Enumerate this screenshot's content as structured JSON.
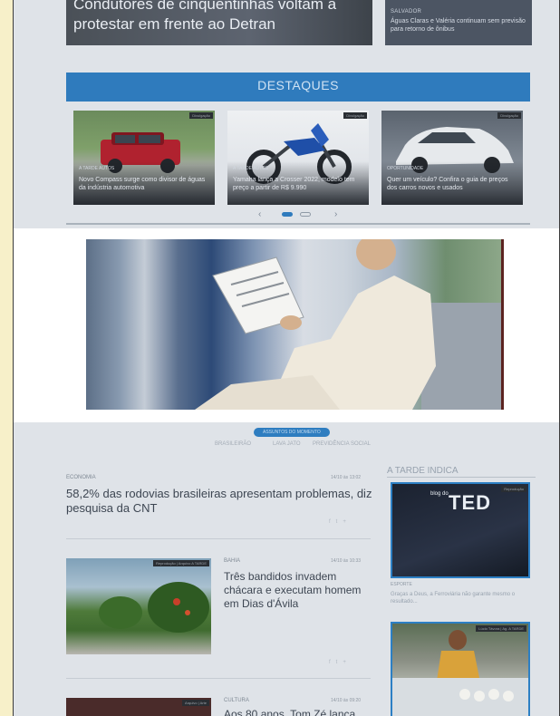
{
  "top": {
    "hero_headline": "Condutores de cinquentinhas voltam a protestar em frente ao Detran",
    "side_kicker": "SALVADOR",
    "side_headline": "Águas Claras e Valéria continuam sem previsão para retorno de ônibus"
  },
  "destaques": {
    "title": "DESTAQUES",
    "cards": [
      {
        "tag": "Divulgação",
        "kicker": "A TARDE AUTOS",
        "caption": "Novo Compass surge como divisor de águas da indústria automotiva"
      },
      {
        "tag": "Divulgação",
        "kicker": "A TARDE AUTOS",
        "caption": "Yamaha lança a Crosser 2022, modelo tem preço a partir de R$ 9.990"
      },
      {
        "tag": "Divulgação",
        "kicker": "OPORTUNIDADE",
        "caption": "Quer um veículo? Confira o guia de preços dos carros novos e usados"
      }
    ],
    "prev": "‹",
    "next": "›"
  },
  "trending": {
    "pill": "ASSUNTOS DO MOMENTO",
    "links": [
      "BRASILEIRÃO",
      "LAVA JATO",
      "PREVIDÊNCIA SOCIAL"
    ]
  },
  "articles": [
    {
      "kicker": "ECONOMIA",
      "time": "14/10 às 13:02",
      "headline": "58,2% das rodovias brasileiras apresentam problemas, diz pesquisa da CNT"
    },
    {
      "kicker": "BAHIA",
      "time": "14/10 às 10:33",
      "headline": "Três bandidos invadem chácara e executam homem em Dias d'Ávila",
      "photo_tag": "Reprodução | Arquivo A TARDE"
    },
    {
      "kicker": "CULTURA",
      "time": "14/10 às 09:20",
      "headline": "Aos 80 anos, Tom Zé lança",
      "photo_tag": "Arquivo | Arte"
    }
  ],
  "share_icons": [
    "f",
    "t",
    "+"
  ],
  "sidebar": {
    "title": "A TARDE INDICA",
    "cards": [
      {
        "tag": "Reprodução",
        "logo_small": "blog do",
        "logo": "TED",
        "kicker": "ESPORTE",
        "desc": "Graças a Deus, a Ferroviária não garante mesmo o resultado..."
      },
      {
        "tag": "Lúcio Távora | Ag. A TARDE"
      }
    ]
  },
  "colors": {
    "accent": "#2f7bbd",
    "page_bg": "#f7f0c9",
    "card_border": "#2c7fc4"
  }
}
